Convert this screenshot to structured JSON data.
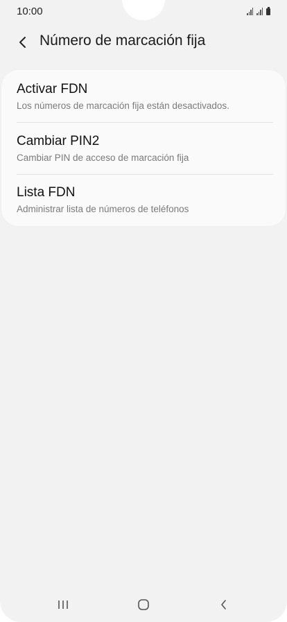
{
  "status_bar": {
    "time": "10:00"
  },
  "app_bar": {
    "back_icon": "chevron-left-icon",
    "title": "Número de marcación fija"
  },
  "settings": {
    "items": [
      {
        "title": "Activar FDN",
        "subtitle": "Los números de marcación fija están desactivados."
      },
      {
        "title": "Cambiar PIN2",
        "subtitle": "Cambiar PIN de acceso de marcación fija"
      },
      {
        "title": "Lista FDN",
        "subtitle": "Administrar lista de números de teléfonos"
      }
    ]
  },
  "nav_bar": {
    "recents_icon": "recents-icon",
    "home_icon": "home-icon",
    "back_icon": "back-icon"
  },
  "colors": {
    "background": "#f2f2f2",
    "card": "#fafafa",
    "title_text": "#111111",
    "subtitle_text": "#7a7a7a"
  }
}
